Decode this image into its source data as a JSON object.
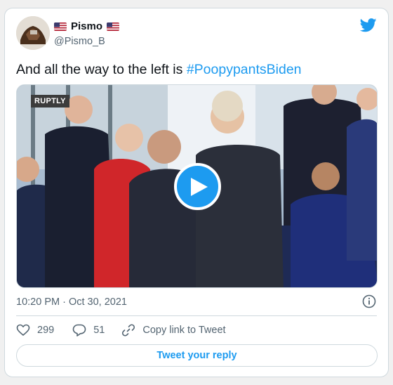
{
  "tweet": {
    "author": {
      "display_name": "Pismo",
      "handle": "@Pismo_B",
      "flag_left": "us-flag-icon",
      "flag_right": "us-flag-icon"
    },
    "text_prefix": "And all the way to the left is ",
    "hashtag": "#PoopypantsBiden",
    "media": {
      "watermark": "RUPTLY",
      "play_icon": "play-icon"
    },
    "timestamp": "10:20 PM · Oct 30, 2021",
    "likes": "299",
    "replies": "51",
    "copy_link_label": "Copy link to Tweet",
    "reply_button_label": "Tweet your reply"
  },
  "colors": {
    "accent": "#1d9bf0",
    "text": "#0f1419",
    "secondary": "#536471",
    "border": "#cfd9de"
  }
}
